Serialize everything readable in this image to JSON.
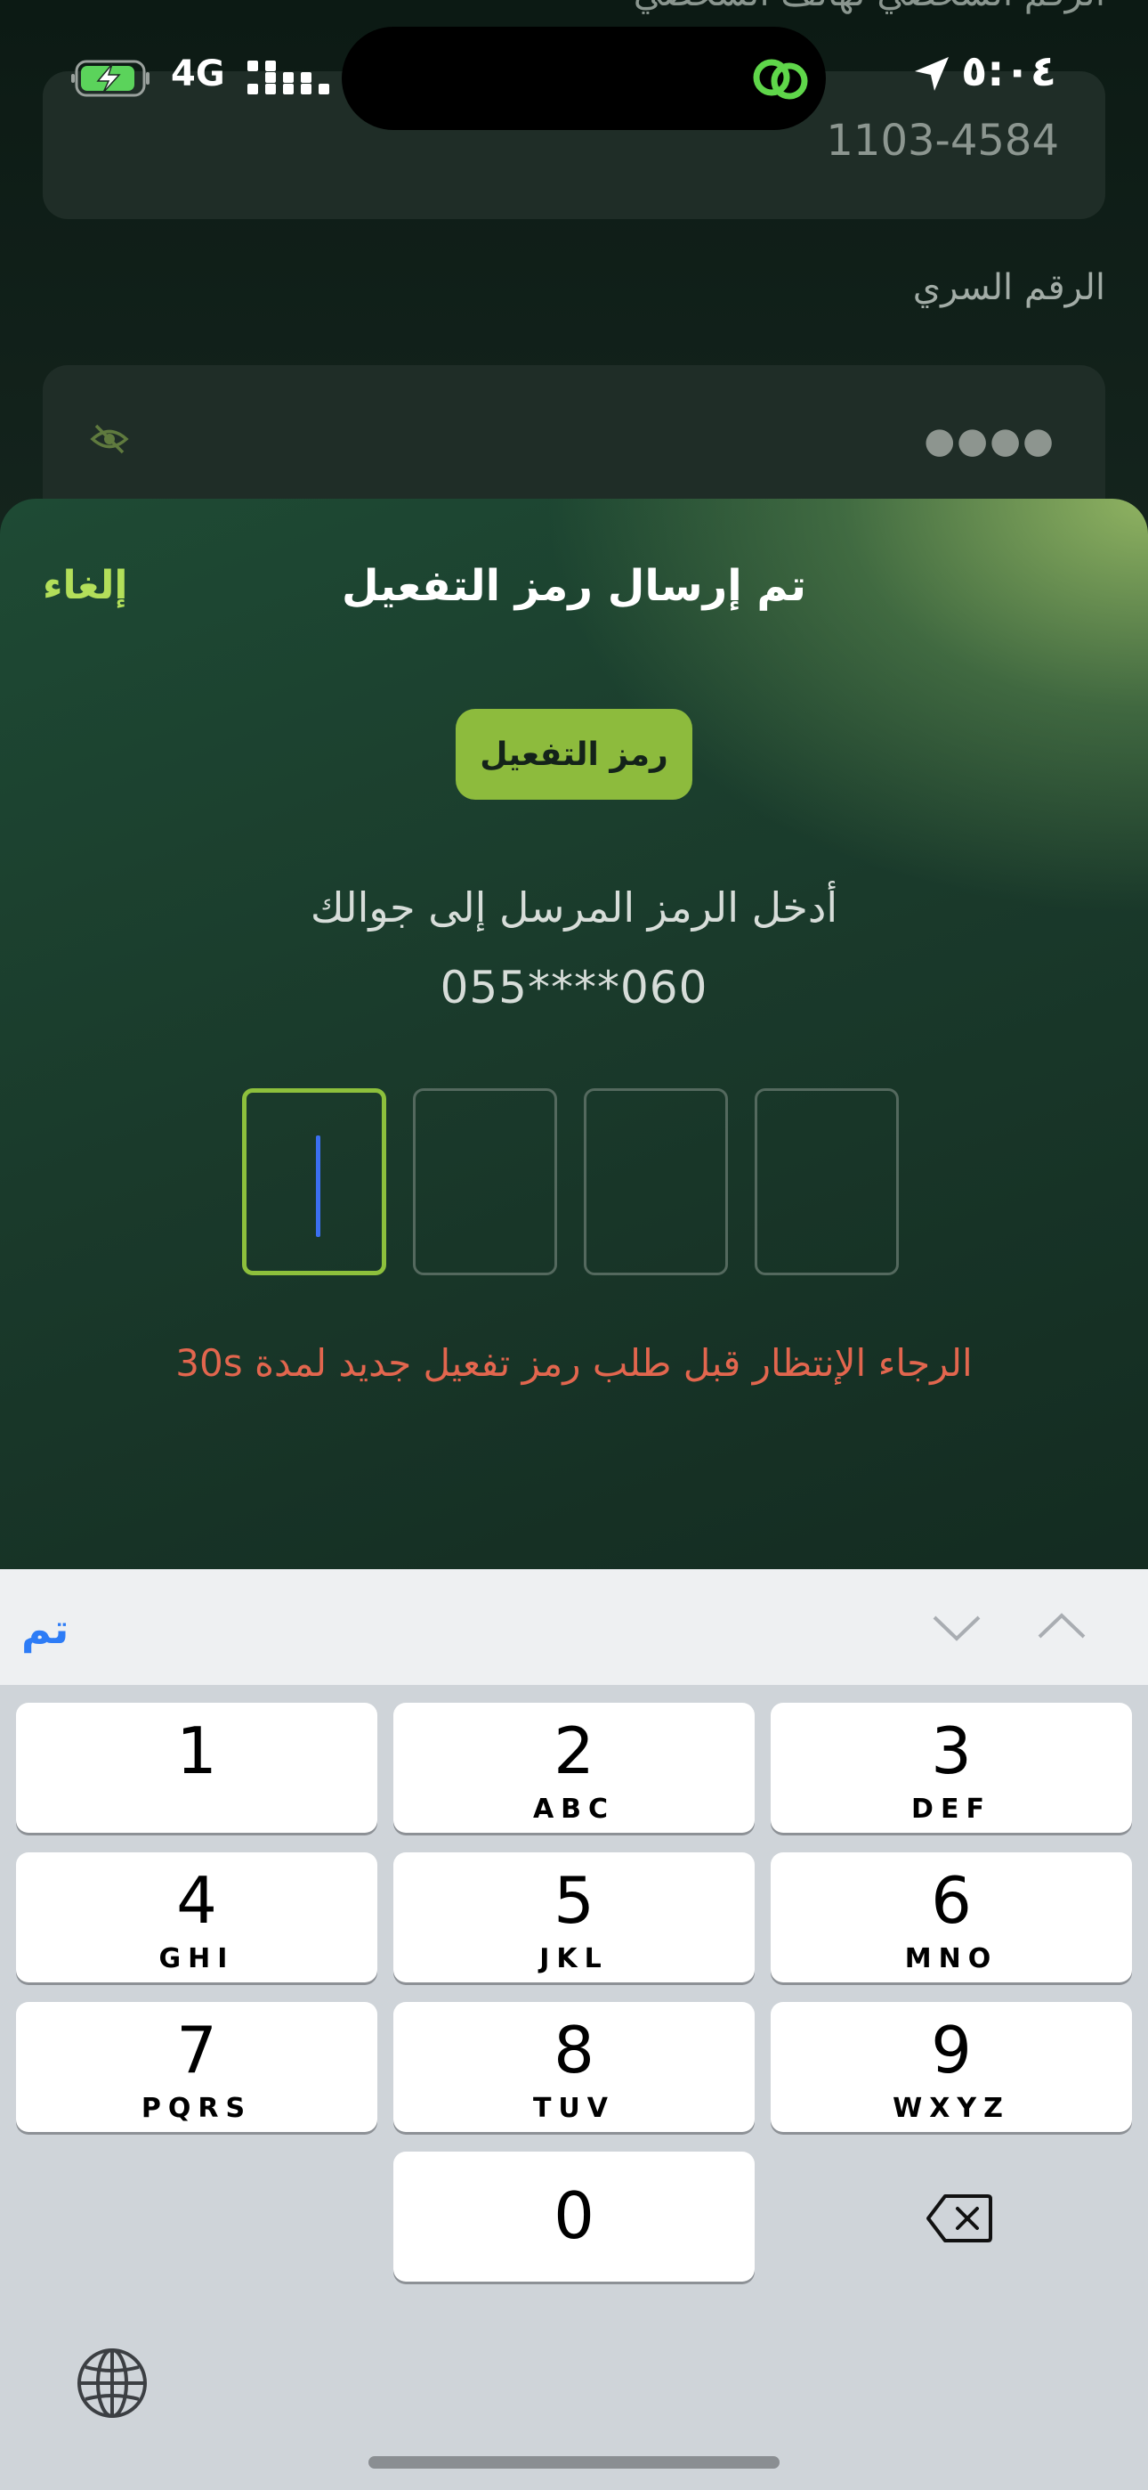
{
  "background": {
    "top_label": "الرقم الشخصي لهاتف الشخصي",
    "phone_value": "1103-4584",
    "pin_label": "الرقم السري",
    "pin_dots": "●●●●"
  },
  "status_bar": {
    "battery_icon": "battery-charging-icon",
    "network": "4G",
    "time": "٥:٠٤"
  },
  "sheet": {
    "cancel": "إلغاء",
    "title": "تم إرسال رمز التفعيل",
    "chip": "رمز التفعيل",
    "instruction": "أدخل الرمز المرسل إلى جوالك",
    "masked_phone": "055****060",
    "wait_message": "الرجاء الإنتظار قبل طلب رمز تفعيل جديد لمدة 30s",
    "accent_color": "#8dbb3d",
    "error_color": "#e2664e"
  },
  "keyboard": {
    "done": "تم",
    "keys": [
      {
        "digit": "1",
        "letters": ""
      },
      {
        "digit": "2",
        "letters": "ABC"
      },
      {
        "digit": "3",
        "letters": "DEF"
      },
      {
        "digit": "4",
        "letters": "GHI"
      },
      {
        "digit": "5",
        "letters": "JKL"
      },
      {
        "digit": "6",
        "letters": "MNO"
      },
      {
        "digit": "7",
        "letters": "PQRS"
      },
      {
        "digit": "8",
        "letters": "TUV"
      },
      {
        "digit": "9",
        "letters": "WXYZ"
      },
      {
        "digit": "0",
        "letters": ""
      }
    ]
  }
}
